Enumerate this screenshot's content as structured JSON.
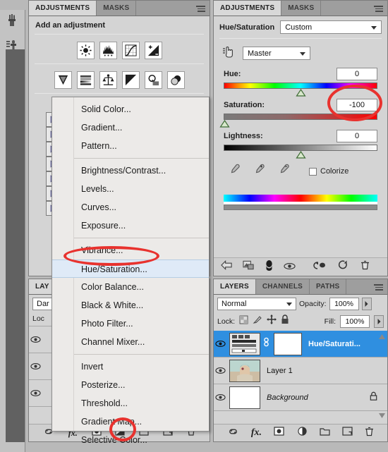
{
  "toolstrip": {
    "tools": [
      {
        "name": "brush-tools-icon",
        "label": "Tools"
      },
      {
        "name": "clone-stamp-icon",
        "label": "Clone Stamp"
      }
    ]
  },
  "adjustments_panel": {
    "tabs": [
      {
        "label": "ADJUSTMENTS",
        "active": true
      },
      {
        "label": "MASKS",
        "active": false
      }
    ],
    "heading": "Add an adjustment",
    "icons_row1": [
      {
        "name": "brightness-contrast-icon",
        "label": "Brightness/Contrast"
      },
      {
        "name": "levels-icon",
        "label": "Levels"
      },
      {
        "name": "curves-icon",
        "label": "Curves"
      },
      {
        "name": "exposure-icon",
        "label": "Exposure"
      }
    ],
    "icons_row2": [
      {
        "name": "vibrance-icon",
        "label": "Vibrance"
      },
      {
        "name": "hue-saturation-icon",
        "label": "Hue/Saturation"
      },
      {
        "name": "color-balance-icon",
        "label": "Color Balance"
      },
      {
        "name": "black-white-icon",
        "label": "Black & White"
      },
      {
        "name": "photo-filter-icon",
        "label": "Photo Filter"
      },
      {
        "name": "channel-mixer-icon",
        "label": "Channel Mixer"
      }
    ]
  },
  "flyout_menu": {
    "items": [
      {
        "label": "Solid Color...",
        "selected": false,
        "sep_after": false
      },
      {
        "label": "Gradient...",
        "selected": false,
        "sep_after": false
      },
      {
        "label": "Pattern...",
        "selected": false,
        "sep_after": true
      },
      {
        "label": "Brightness/Contrast...",
        "selected": false,
        "sep_after": false
      },
      {
        "label": "Levels...",
        "selected": false,
        "sep_after": false
      },
      {
        "label": "Curves...",
        "selected": false,
        "sep_after": false
      },
      {
        "label": "Exposure...",
        "selected": false,
        "sep_after": true
      },
      {
        "label": "Vibrance...",
        "selected": false,
        "sep_after": false
      },
      {
        "label": "Hue/Saturation...",
        "selected": true,
        "sep_after": false
      },
      {
        "label": "Color Balance...",
        "selected": false,
        "sep_after": false
      },
      {
        "label": "Black & White...",
        "selected": false,
        "sep_after": false
      },
      {
        "label": "Photo Filter...",
        "selected": false,
        "sep_after": false
      },
      {
        "label": "Channel Mixer...",
        "selected": false,
        "sep_after": true
      },
      {
        "label": "Invert",
        "selected": false,
        "sep_after": false
      },
      {
        "label": "Posterize...",
        "selected": false,
        "sep_after": false
      },
      {
        "label": "Threshold...",
        "selected": false,
        "sep_after": false
      },
      {
        "label": "Gradient Map...",
        "selected": false,
        "sep_after": false
      },
      {
        "label": "Selective Color...",
        "selected": false,
        "sep_after": false
      }
    ]
  },
  "hue_saturation_panel": {
    "tabs": [
      {
        "label": "ADJUSTMENTS",
        "active": true
      },
      {
        "label": "MASKS",
        "active": false
      }
    ],
    "title": "Hue/Saturation",
    "preset": "Custom",
    "channel": "Master",
    "sliders": [
      {
        "name": "hue",
        "label": "Hue:",
        "value": "0",
        "thumb_pct": 50
      },
      {
        "name": "saturation",
        "label": "Saturation:",
        "value": "-100",
        "thumb_pct": 0
      },
      {
        "name": "lightness",
        "label": "Lightness:",
        "value": "0",
        "thumb_pct": 50
      }
    ],
    "eyedroppers": [
      {
        "name": "eyedropper-icon"
      },
      {
        "name": "eyedropper-add-icon"
      },
      {
        "name": "eyedropper-subtract-icon"
      }
    ],
    "colorize_label": "Colorize",
    "colorize_checked": false,
    "footer_icons": [
      {
        "name": "return-to-adjustment-list-icon"
      },
      {
        "name": "clip-to-layer-icon"
      },
      {
        "name": "toggle-layer-visibility-icon"
      },
      {
        "name": "preview-eye-icon"
      },
      {
        "name": "reset-previous-state-icon"
      },
      {
        "name": "reset-adjustment-icon"
      },
      {
        "name": "delete-adjustment-icon"
      }
    ]
  },
  "layers_panel": {
    "tabs": [
      {
        "label": "LAYERS",
        "active": true
      },
      {
        "label": "CHANNELS",
        "active": false
      },
      {
        "label": "PATHS",
        "active": false
      }
    ],
    "blend_mode": "Normal",
    "opacity_label": "Opacity:",
    "opacity_value": "100%",
    "lock_label": "Lock:",
    "fill_label": "Fill:",
    "fill_value": "100%",
    "lock_icons": [
      {
        "name": "lock-transparent-pixels-icon"
      },
      {
        "name": "lock-image-pixels-icon"
      },
      {
        "name": "lock-position-icon"
      },
      {
        "name": "lock-all-icon"
      }
    ],
    "layers": [
      {
        "name": "Hue/Saturati...",
        "selected": true,
        "kind": "adjustment",
        "locked": false
      },
      {
        "name": "Layer 1",
        "selected": false,
        "kind": "image",
        "locked": false
      },
      {
        "name": "Background",
        "selected": false,
        "kind": "background",
        "locked": true
      }
    ],
    "footer_icons": [
      {
        "name": "link-layers-icon"
      },
      {
        "name": "layer-style-fx-icon"
      },
      {
        "name": "add-layer-mask-icon"
      },
      {
        "name": "new-adjustment-layer-icon"
      },
      {
        "name": "new-group-icon"
      },
      {
        "name": "new-layer-icon"
      },
      {
        "name": "delete-layer-icon"
      }
    ]
  },
  "left_layers_panel": {
    "tab_label": "LAY",
    "blend_mode": "Dar",
    "lock_label": "Loc",
    "rows": 3,
    "footer_icons": [
      {
        "name": "link-layers-icon"
      },
      {
        "name": "layer-style-fx-icon"
      },
      {
        "name": "add-layer-mask-icon"
      },
      {
        "name": "new-adjustment-layer-icon"
      },
      {
        "name": "new-group-icon"
      },
      {
        "name": "new-layer-icon"
      },
      {
        "name": "delete-layer-icon"
      }
    ]
  },
  "annotations": {
    "color": "#e8322e",
    "marks": [
      {
        "name": "annotation-saturation-value",
        "target": "saturation value -100"
      },
      {
        "name": "annotation-hue-saturation-menu-item",
        "target": "Hue/Saturation... menu item"
      },
      {
        "name": "annotation-new-adjustment-layer-button",
        "target": "new adjustment layer button"
      }
    ]
  }
}
